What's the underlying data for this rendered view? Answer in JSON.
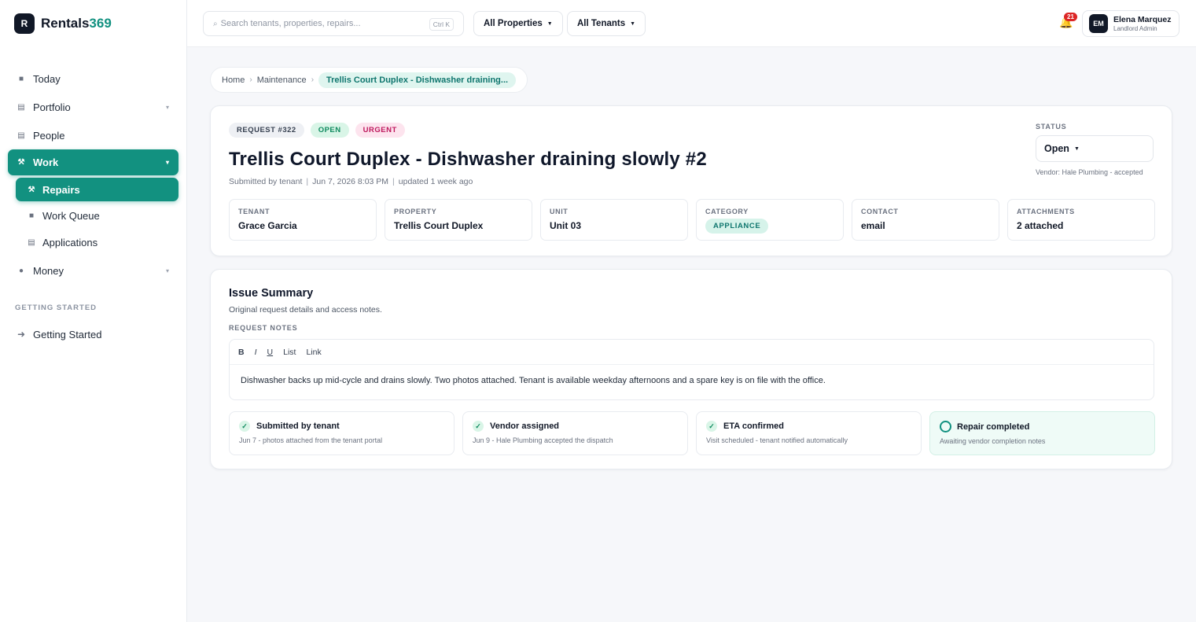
{
  "brand": {
    "mark": "R",
    "name_main": "Rentals",
    "name_accent": "369"
  },
  "sidebar": {
    "items": [
      {
        "label": "Today",
        "icon": "square-icon"
      },
      {
        "label": "Portfolio",
        "icon": "list-icon"
      },
      {
        "label": "People",
        "icon": "list-icon"
      },
      {
        "label": "Work",
        "icon": "tools-icon"
      },
      {
        "label": "Repairs",
        "icon": "tools-icon"
      },
      {
        "label": "Work Queue",
        "icon": "square-icon"
      },
      {
        "label": "Applications",
        "icon": "list-icon"
      },
      {
        "label": "Money",
        "icon": "coin-icon"
      }
    ],
    "section_label": "GETTING STARTED",
    "getting_started": "Getting Started"
  },
  "topbar": {
    "search_placeholder": "Search tenants, properties, repairs...",
    "search_shortcut": "Ctrl K",
    "filter_properties": "All Properties",
    "filter_tenants": "All Tenants",
    "notification_count": "21",
    "user": {
      "initials": "EM",
      "name": "Elena Marquez",
      "role": "Landlord Admin"
    }
  },
  "breadcrumb": {
    "home": "Home",
    "section": "Maintenance",
    "current": "Trellis Court Duplex - Dishwasher draining..."
  },
  "request": {
    "number": "REQUEST #322",
    "state_pill": "OPEN",
    "priority_pill": "URGENT",
    "title": "Trellis Court Duplex - Dishwasher draining slowly #2",
    "submitted_by": "Submitted by tenant",
    "submitted_at": "Jun 7, 2026 8:03 PM",
    "updated": "updated 1 week ago",
    "status_label": "STATUS",
    "status_value": "Open",
    "vendor_note": "Vendor: Hale Plumbing - accepted",
    "facts": [
      {
        "label": "TENANT",
        "value": "Grace Garcia"
      },
      {
        "label": "PROPERTY",
        "value": "Trellis Court Duplex"
      },
      {
        "label": "UNIT",
        "value": "Unit 03"
      },
      {
        "label": "CATEGORY",
        "value": "APPLIANCE"
      },
      {
        "label": "CONTACT",
        "value": "email"
      },
      {
        "label": "ATTACHMENTS",
        "value": "2 attached"
      }
    ]
  },
  "issue": {
    "title": "Issue Summary",
    "subtitle": "Original request details and access notes.",
    "notes_label": "REQUEST NOTES",
    "toolbar": {
      "bold": "B",
      "italic": "I",
      "underline": "U",
      "list": "List",
      "link": "Link"
    },
    "notes": "Dishwasher backs up mid-cycle and drains slowly. Two photos attached. Tenant is available weekday afternoons and a spare key is on file with the office.",
    "steps": [
      {
        "title": "Submitted by tenant",
        "desc": "Jun 7 - photos attached from the tenant portal",
        "done": true
      },
      {
        "title": "Vendor assigned",
        "desc": "Jun 9 - Hale Plumbing accepted the dispatch",
        "done": true
      },
      {
        "title": "ETA confirmed",
        "desc": "Visit scheduled - tenant notified automatically",
        "done": true
      },
      {
        "title": "Repair completed",
        "desc": "Awaiting vendor completion notes",
        "done": false
      }
    ]
  },
  "colors": {
    "accent": "#129180",
    "open": "#0f8a5f",
    "urgent": "#be185d",
    "notification": "#dc2626"
  }
}
